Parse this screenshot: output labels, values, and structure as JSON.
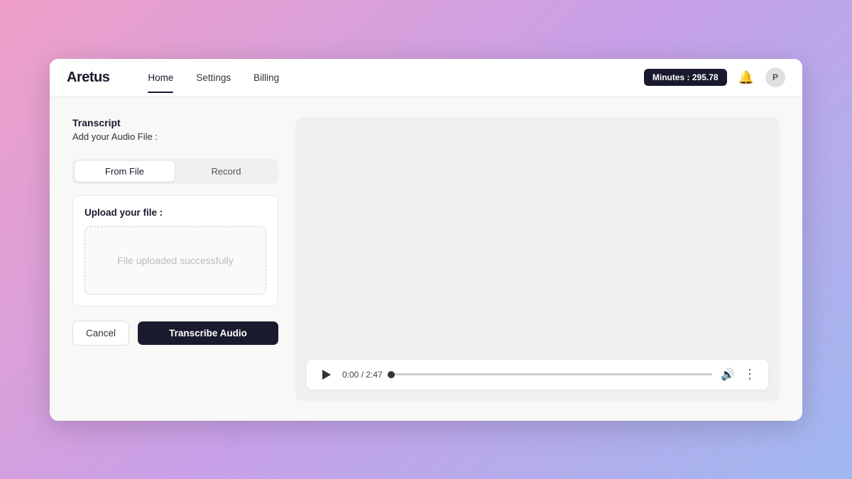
{
  "app": {
    "logo": "Aretus",
    "minutes_badge": "Minutes : 295.78"
  },
  "navbar": {
    "items": [
      {
        "label": "Home",
        "active": true
      },
      {
        "label": "Settings",
        "active": false
      },
      {
        "label": "Billing",
        "active": false
      }
    ],
    "user_initial": "P"
  },
  "left_panel": {
    "section_title": "Transcript",
    "add_file_label": "Add your Audio File :",
    "toggle_from_file": "From File",
    "toggle_record": "Record",
    "upload_label": "Upload your file :",
    "upload_status": "File uploaded successfully",
    "cancel_label": "Cancel",
    "transcribe_label": "Transcribe Audio"
  },
  "audio_player": {
    "time_current": "0:00",
    "time_total": "2:47",
    "time_display": "0:00 / 2:47"
  },
  "icons": {
    "bell": "🔔",
    "volume": "🔊",
    "more": "⋮"
  }
}
